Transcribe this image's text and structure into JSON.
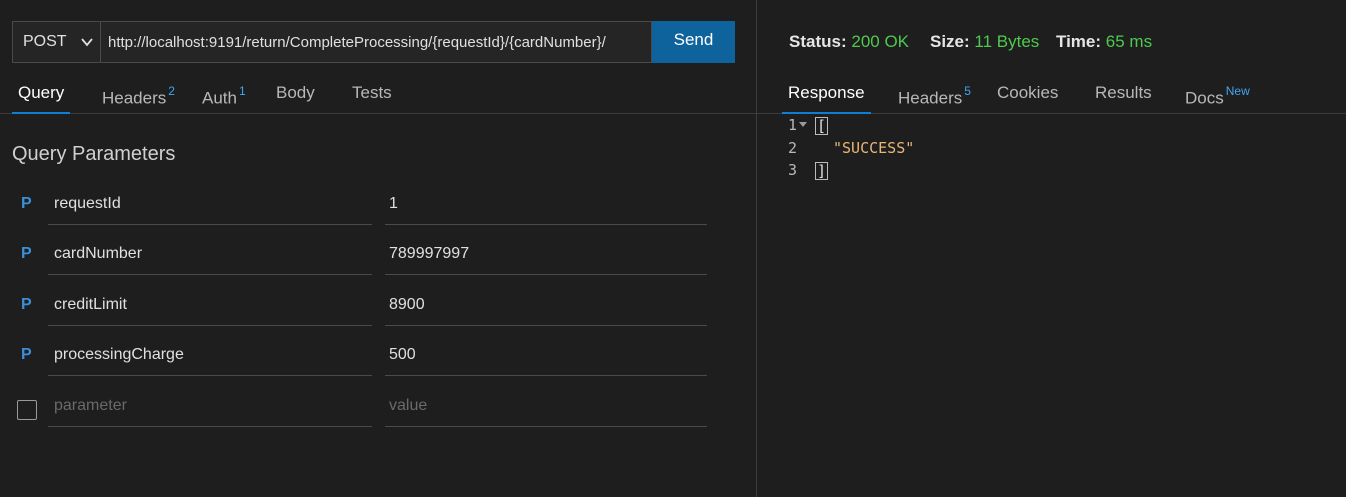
{
  "request": {
    "method": "POST",
    "url": "http://localhost:9191/return/CompleteProcessing/{requestId}/{cardNumber}/",
    "send_label": "Send"
  },
  "request_tabs": [
    {
      "label": "Query",
      "badge": ""
    },
    {
      "label": "Headers",
      "badge": "2"
    },
    {
      "label": "Auth",
      "badge": "1"
    },
    {
      "label": "Body",
      "badge": ""
    },
    {
      "label": "Tests",
      "badge": ""
    }
  ],
  "query": {
    "title": "Query Parameters",
    "param_marker": "P",
    "params": [
      {
        "key": "requestId",
        "value": "1"
      },
      {
        "key": "cardNumber",
        "value": "789997997"
      },
      {
        "key": "creditLimit",
        "value": "8900"
      },
      {
        "key": "processingCharge",
        "value": "500"
      }
    ],
    "new_param": {
      "key_placeholder": "parameter",
      "value_placeholder": "value"
    }
  },
  "response_meta": {
    "status_label": "Status:",
    "status_value": "200 OK",
    "size_label": "Size:",
    "size_value": "11 Bytes",
    "time_label": "Time:",
    "time_value": "65 ms"
  },
  "response_tabs": [
    {
      "label": "Response",
      "badge": ""
    },
    {
      "label": "Headers",
      "badge": "5"
    },
    {
      "label": "Cookies",
      "badge": ""
    },
    {
      "label": "Results",
      "badge": ""
    },
    {
      "label": "Docs",
      "badge": "New"
    }
  ],
  "response_body": {
    "lines": [
      {
        "num": "1",
        "text": "["
      },
      {
        "num": "2",
        "text": "\"SUCCESS\""
      },
      {
        "num": "3",
        "text": "]"
      }
    ]
  },
  "colors": {
    "accent": "#0e639c",
    "success": "#4ec94e",
    "string": "#e8b676",
    "param_marker": "#3a8fd8"
  }
}
